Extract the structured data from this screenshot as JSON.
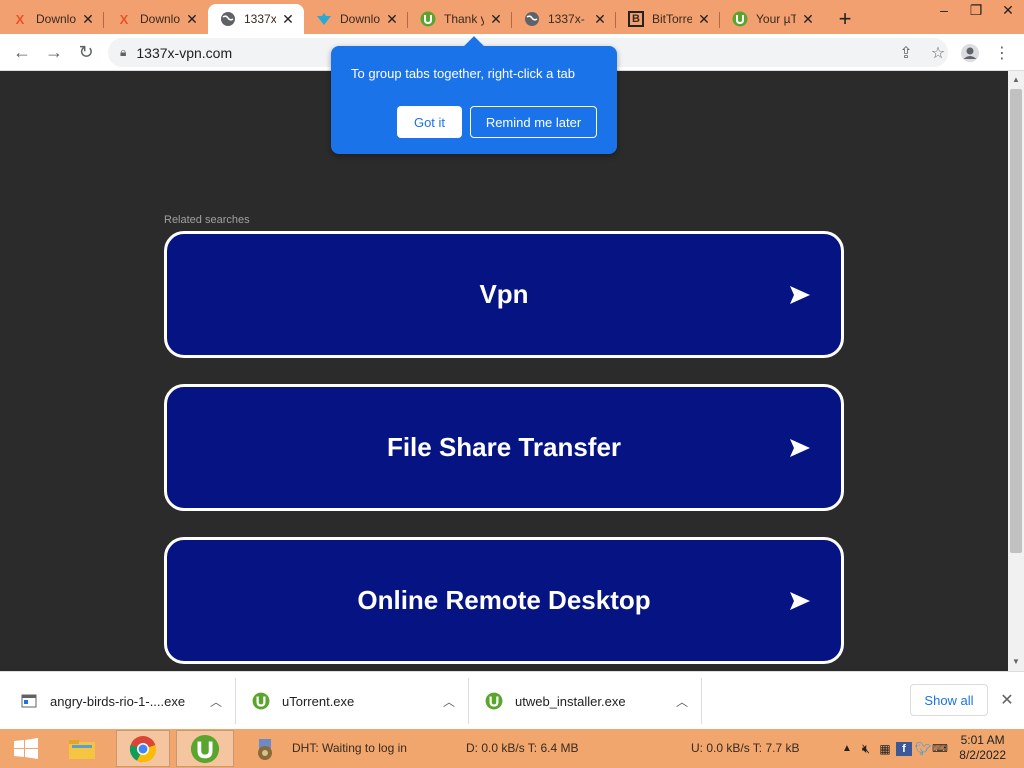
{
  "tabs": [
    {
      "label": "Downlo",
      "icon": "x-logo-icon",
      "active": false
    },
    {
      "label": "Downlo",
      "icon": "x-logo-icon",
      "active": false
    },
    {
      "label": "1337x-",
      "icon": "globe-icon",
      "active": true
    },
    {
      "label": "Downlo",
      "icon": "download-arrow-icon",
      "active": false
    },
    {
      "label": "Thank y",
      "icon": "utorrent-icon",
      "active": false
    },
    {
      "label": "1337x-",
      "icon": "globe-icon",
      "active": false
    },
    {
      "label": "BitTorre",
      "icon": "bittorrent-b-icon",
      "active": false
    },
    {
      "label": "Your µT",
      "icon": "utorrent-icon",
      "active": false
    }
  ],
  "address": {
    "url": "1337x-vpn.com"
  },
  "popup": {
    "text": "To group tabs together, right-click a tab",
    "got_it": "Got it",
    "remind_later": "Remind me later"
  },
  "page": {
    "related_label": "Related searches",
    "results": [
      "Vpn",
      "File Share Transfer",
      "Online Remote Desktop"
    ]
  },
  "downloads": {
    "items": [
      "angry-birds-rio-1-....exe",
      "uTorrent.exe",
      "utweb_installer.exe"
    ],
    "show_all": "Show all"
  },
  "taskbar": {
    "dht_status": "DHT: Waiting to log in",
    "download_status": "D: 0.0 kB/s T: 6.4 MB",
    "upload_status": "U: 0.0 kB/s T: 7.7 kB",
    "time": "5:01 AM",
    "date": "8/2/2022"
  },
  "colors": {
    "tabstrip": "#f2a070",
    "popup": "#1a73e8",
    "result_bg": "#061382",
    "taskbar": "#f0a66c",
    "utorrent_green": "#5aa52d"
  }
}
